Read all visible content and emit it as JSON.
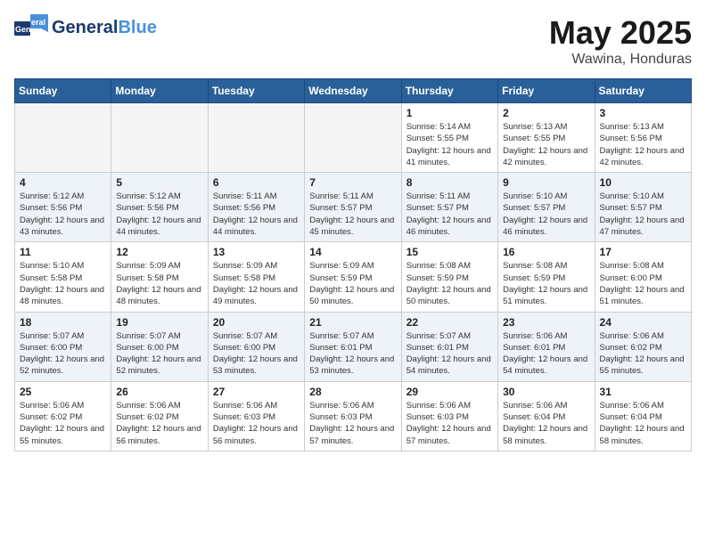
{
  "header": {
    "logo_general": "General",
    "logo_blue": "Blue",
    "month_year": "May 2025",
    "location": "Wawina, Honduras"
  },
  "weekdays": [
    "Sunday",
    "Monday",
    "Tuesday",
    "Wednesday",
    "Thursday",
    "Friday",
    "Saturday"
  ],
  "weeks": [
    [
      {
        "day": "",
        "empty": true
      },
      {
        "day": "",
        "empty": true
      },
      {
        "day": "",
        "empty": true
      },
      {
        "day": "",
        "empty": true
      },
      {
        "day": "1",
        "sunrise": "Sunrise: 5:14 AM",
        "sunset": "Sunset: 5:55 PM",
        "daylight": "Daylight: 12 hours and 41 minutes."
      },
      {
        "day": "2",
        "sunrise": "Sunrise: 5:13 AM",
        "sunset": "Sunset: 5:55 PM",
        "daylight": "Daylight: 12 hours and 42 minutes."
      },
      {
        "day": "3",
        "sunrise": "Sunrise: 5:13 AM",
        "sunset": "Sunset: 5:56 PM",
        "daylight": "Daylight: 12 hours and 42 minutes."
      }
    ],
    [
      {
        "day": "4",
        "sunrise": "Sunrise: 5:12 AM",
        "sunset": "Sunset: 5:56 PM",
        "daylight": "Daylight: 12 hours and 43 minutes."
      },
      {
        "day": "5",
        "sunrise": "Sunrise: 5:12 AM",
        "sunset": "Sunset: 5:56 PM",
        "daylight": "Daylight: 12 hours and 44 minutes."
      },
      {
        "day": "6",
        "sunrise": "Sunrise: 5:11 AM",
        "sunset": "Sunset: 5:56 PM",
        "daylight": "Daylight: 12 hours and 44 minutes."
      },
      {
        "day": "7",
        "sunrise": "Sunrise: 5:11 AM",
        "sunset": "Sunset: 5:57 PM",
        "daylight": "Daylight: 12 hours and 45 minutes."
      },
      {
        "day": "8",
        "sunrise": "Sunrise: 5:11 AM",
        "sunset": "Sunset: 5:57 PM",
        "daylight": "Daylight: 12 hours and 46 minutes."
      },
      {
        "day": "9",
        "sunrise": "Sunrise: 5:10 AM",
        "sunset": "Sunset: 5:57 PM",
        "daylight": "Daylight: 12 hours and 46 minutes."
      },
      {
        "day": "10",
        "sunrise": "Sunrise: 5:10 AM",
        "sunset": "Sunset: 5:57 PM",
        "daylight": "Daylight: 12 hours and 47 minutes."
      }
    ],
    [
      {
        "day": "11",
        "sunrise": "Sunrise: 5:10 AM",
        "sunset": "Sunset: 5:58 PM",
        "daylight": "Daylight: 12 hours and 48 minutes."
      },
      {
        "day": "12",
        "sunrise": "Sunrise: 5:09 AM",
        "sunset": "Sunset: 5:58 PM",
        "daylight": "Daylight: 12 hours and 48 minutes."
      },
      {
        "day": "13",
        "sunrise": "Sunrise: 5:09 AM",
        "sunset": "Sunset: 5:58 PM",
        "daylight": "Daylight: 12 hours and 49 minutes."
      },
      {
        "day": "14",
        "sunrise": "Sunrise: 5:09 AM",
        "sunset": "Sunset: 5:59 PM",
        "daylight": "Daylight: 12 hours and 50 minutes."
      },
      {
        "day": "15",
        "sunrise": "Sunrise: 5:08 AM",
        "sunset": "Sunset: 5:59 PM",
        "daylight": "Daylight: 12 hours and 50 minutes."
      },
      {
        "day": "16",
        "sunrise": "Sunrise: 5:08 AM",
        "sunset": "Sunset: 5:59 PM",
        "daylight": "Daylight: 12 hours and 51 minutes."
      },
      {
        "day": "17",
        "sunrise": "Sunrise: 5:08 AM",
        "sunset": "Sunset: 6:00 PM",
        "daylight": "Daylight: 12 hours and 51 minutes."
      }
    ],
    [
      {
        "day": "18",
        "sunrise": "Sunrise: 5:07 AM",
        "sunset": "Sunset: 6:00 PM",
        "daylight": "Daylight: 12 hours and 52 minutes."
      },
      {
        "day": "19",
        "sunrise": "Sunrise: 5:07 AM",
        "sunset": "Sunset: 6:00 PM",
        "daylight": "Daylight: 12 hours and 52 minutes."
      },
      {
        "day": "20",
        "sunrise": "Sunrise: 5:07 AM",
        "sunset": "Sunset: 6:00 PM",
        "daylight": "Daylight: 12 hours and 53 minutes."
      },
      {
        "day": "21",
        "sunrise": "Sunrise: 5:07 AM",
        "sunset": "Sunset: 6:01 PM",
        "daylight": "Daylight: 12 hours and 53 minutes."
      },
      {
        "day": "22",
        "sunrise": "Sunrise: 5:07 AM",
        "sunset": "Sunset: 6:01 PM",
        "daylight": "Daylight: 12 hours and 54 minutes."
      },
      {
        "day": "23",
        "sunrise": "Sunrise: 5:06 AM",
        "sunset": "Sunset: 6:01 PM",
        "daylight": "Daylight: 12 hours and 54 minutes."
      },
      {
        "day": "24",
        "sunrise": "Sunrise: 5:06 AM",
        "sunset": "Sunset: 6:02 PM",
        "daylight": "Daylight: 12 hours and 55 minutes."
      }
    ],
    [
      {
        "day": "25",
        "sunrise": "Sunrise: 5:06 AM",
        "sunset": "Sunset: 6:02 PM",
        "daylight": "Daylight: 12 hours and 55 minutes."
      },
      {
        "day": "26",
        "sunrise": "Sunrise: 5:06 AM",
        "sunset": "Sunset: 6:02 PM",
        "daylight": "Daylight: 12 hours and 56 minutes."
      },
      {
        "day": "27",
        "sunrise": "Sunrise: 5:06 AM",
        "sunset": "Sunset: 6:03 PM",
        "daylight": "Daylight: 12 hours and 56 minutes."
      },
      {
        "day": "28",
        "sunrise": "Sunrise: 5:06 AM",
        "sunset": "Sunset: 6:03 PM",
        "daylight": "Daylight: 12 hours and 57 minutes."
      },
      {
        "day": "29",
        "sunrise": "Sunrise: 5:06 AM",
        "sunset": "Sunset: 6:03 PM",
        "daylight": "Daylight: 12 hours and 57 minutes."
      },
      {
        "day": "30",
        "sunrise": "Sunrise: 5:06 AM",
        "sunset": "Sunset: 6:04 PM",
        "daylight": "Daylight: 12 hours and 58 minutes."
      },
      {
        "day": "31",
        "sunrise": "Sunrise: 5:06 AM",
        "sunset": "Sunset: 6:04 PM",
        "daylight": "Daylight: 12 hours and 58 minutes."
      }
    ]
  ]
}
